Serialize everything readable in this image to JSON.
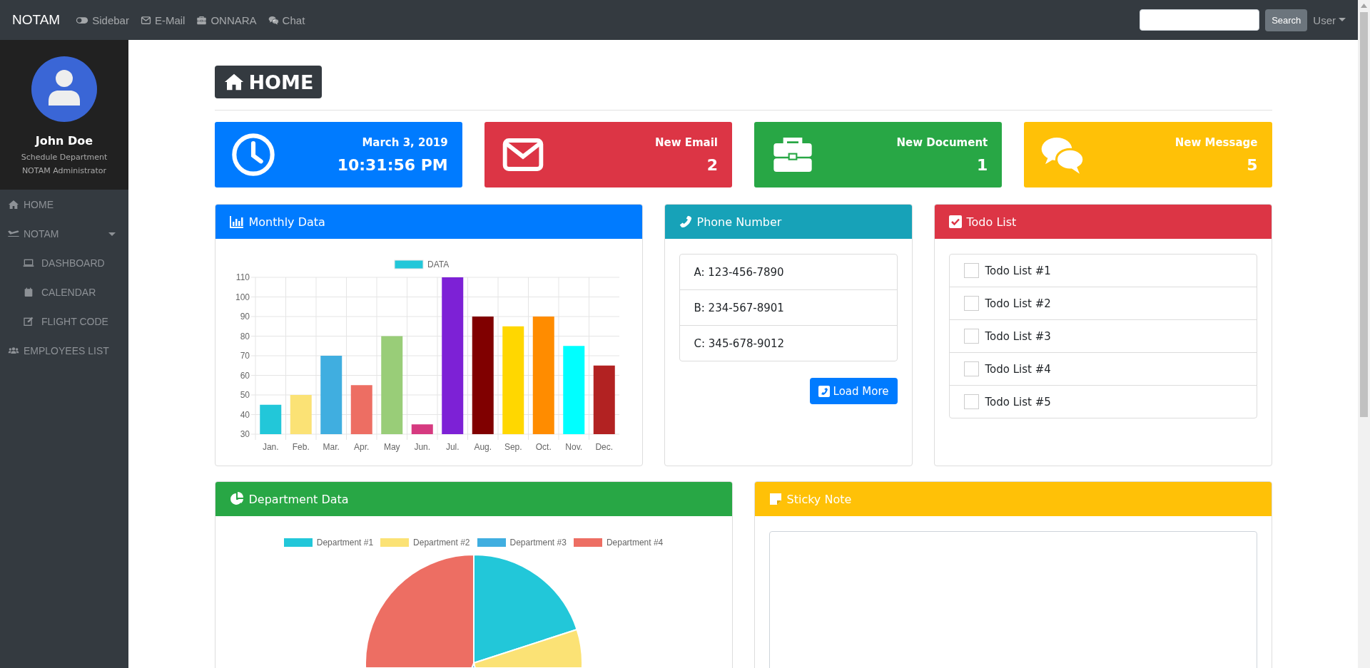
{
  "navbar": {
    "brand": "NOTAM",
    "links": [
      {
        "label": "Sidebar",
        "kind": "toggle"
      },
      {
        "label": "E-Mail",
        "kind": "mail"
      },
      {
        "label": "ONNARA",
        "kind": "briefcase"
      },
      {
        "label": "Chat",
        "kind": "chat"
      }
    ],
    "search_button": "Search",
    "user_menu": "User"
  },
  "sidebar": {
    "profile": {
      "name": "John Doe",
      "department": "Schedule Department",
      "role": "NOTAM Administrator"
    },
    "items": [
      {
        "label": "HOME",
        "kind": "home"
      },
      {
        "label": "NOTAM",
        "kind": "plane",
        "expanded": true,
        "children": [
          {
            "label": "DASHBOARD",
            "kind": "laptop"
          },
          {
            "label": "CALENDAR",
            "kind": "calendar"
          },
          {
            "label": "FLIGHT CODE",
            "kind": "edit"
          }
        ]
      },
      {
        "label": "EMPLOYEES LIST",
        "kind": "users"
      }
    ]
  },
  "page_title": "HOME",
  "stat_cards": [
    {
      "kind": "clock",
      "color": "#007bff",
      "title": "March 3, 2019",
      "value": "10:31:56 PM"
    },
    {
      "kind": "mail",
      "color": "#dc3545",
      "title": "New Email",
      "value": "2"
    },
    {
      "kind": "briefcase",
      "color": "#28a745",
      "title": "New Document",
      "value": "1"
    },
    {
      "kind": "chat",
      "color": "#ffc107",
      "title": "New Message",
      "value": "5"
    }
  ],
  "monthly_card": {
    "title": "Monthly Data",
    "chart_data": {
      "type": "bar",
      "categories": [
        "Jan.",
        "Feb.",
        "Mar.",
        "Apr.",
        "May",
        "Jun.",
        "Jul.",
        "Aug.",
        "Sep.",
        "Oct.",
        "Nov.",
        "Dec."
      ],
      "series": [
        {
          "name": "DATA",
          "values": [
            45,
            50,
            70,
            55,
            80,
            35,
            110,
            90,
            85,
            90,
            75,
            65
          ]
        }
      ],
      "colors": [
        "#22c7d9",
        "#fbe275",
        "#40aee0",
        "#ed6e63",
        "#99cd78",
        "#d63a80",
        "#7d21d6",
        "#800000",
        "#ffd700",
        "#ff8c00",
        "#00ffff",
        "#b22222"
      ],
      "grid": true,
      "ylim": [
        30,
        110
      ],
      "yticks": [
        30,
        40,
        50,
        60,
        70,
        80,
        90,
        100,
        110
      ]
    }
  },
  "phone_card": {
    "title": "Phone Number",
    "numbers": [
      "A: 123-456-7890",
      "B: 234-567-8901",
      "C: 345-678-9012"
    ],
    "button": "Load More"
  },
  "todo_card": {
    "title": "Todo List",
    "items": [
      {
        "label": "Todo List #1",
        "checked": false
      },
      {
        "label": "Todo List #2",
        "checked": false
      },
      {
        "label": "Todo List #3",
        "checked": false
      },
      {
        "label": "Todo List #4",
        "checked": false
      },
      {
        "label": "Todo List #5",
        "checked": false
      }
    ]
  },
  "department_card": {
    "title": "Department Data",
    "legend": [
      {
        "label": "Department #1",
        "color": "#22c7d9"
      },
      {
        "label": "Department #2",
        "color": "#fbe275"
      },
      {
        "label": "Department #3",
        "color": "#40aee0"
      },
      {
        "label": "Department #4",
        "color": "#ed6e63"
      }
    ]
  },
  "sticky_card": {
    "title": "Sticky Note"
  }
}
